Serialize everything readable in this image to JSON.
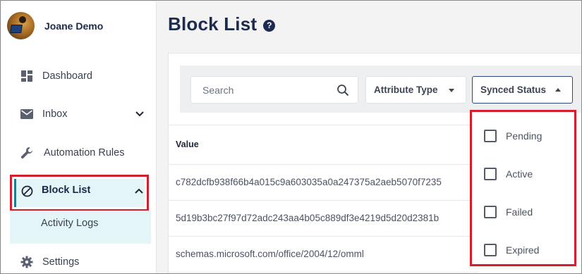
{
  "user": {
    "name": "Joane Demo"
  },
  "sidebar": {
    "items": [
      {
        "label": "Dashboard",
        "icon": "dashboard-icon"
      },
      {
        "label": "Inbox",
        "icon": "mail-icon"
      },
      {
        "label": "Automation Rules",
        "icon": "wrench-icon"
      },
      {
        "label": "Block List",
        "icon": "block-icon",
        "active": true
      },
      {
        "label": "Activity Logs"
      },
      {
        "label": "Settings",
        "icon": "gear-icon"
      }
    ]
  },
  "page": {
    "title": "Block List",
    "help_icon": "?"
  },
  "filters": {
    "search_placeholder": "Search",
    "attribute_type": "Attribute Type",
    "synced_status": "Synced Status",
    "synced_status_options": [
      "Pending",
      "Active",
      "Failed",
      "Expired"
    ]
  },
  "table": {
    "columns": [
      "Value"
    ],
    "rows": [
      "c782dcfb938f66b4a015c9a603035a0a247375a2aeb5070f7235",
      "5d19b3bc27f97d72adc243aa4b05c889df3e4219d5d20d2381b",
      "schemas.microsoft.com/office/2004/12/omml"
    ]
  },
  "colors": {
    "accent": "#1d2b4f",
    "highlight": "#d21f2d",
    "active_bg": "#e4f5f8"
  }
}
